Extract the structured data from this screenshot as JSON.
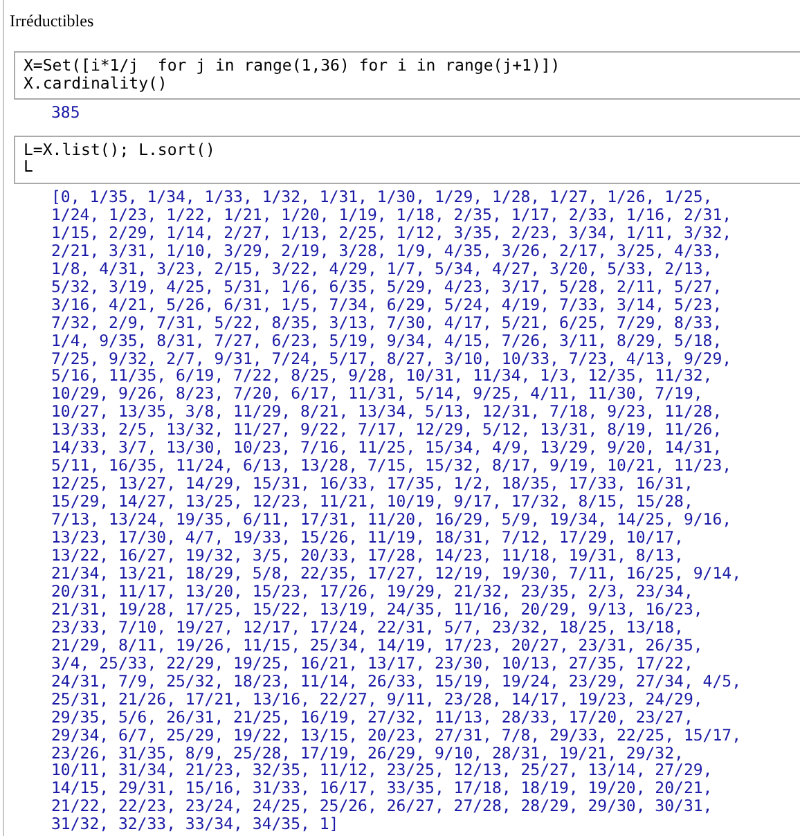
{
  "worksheet": {
    "title": "Irréductibles"
  },
  "cells": [
    {
      "input": [
        "X=Set([i*1/j  for j in range(1,36) for i in range(j+1)])",
        "X.cardinality()"
      ],
      "output": [
        "385"
      ]
    },
    {
      "input": [
        "L=X.list(); L.sort()",
        "L"
      ],
      "output": [
        "[0, 1/35, 1/34, 1/33, 1/32, 1/31, 1/30, 1/29, 1/28, 1/27, 1/26, 1/25,",
        "1/24, 1/23, 1/22, 1/21, 1/20, 1/19, 1/18, 2/35, 1/17, 2/33, 1/16, 2/31,",
        "1/15, 2/29, 1/14, 2/27, 1/13, 2/25, 1/12, 3/35, 2/23, 3/34, 1/11, 3/32,",
        "2/21, 3/31, 1/10, 3/29, 2/19, 3/28, 1/9, 4/35, 3/26, 2/17, 3/25, 4/33,",
        "1/8, 4/31, 3/23, 2/15, 3/22, 4/29, 1/7, 5/34, 4/27, 3/20, 5/33, 2/13,",
        "5/32, 3/19, 4/25, 5/31, 1/6, 6/35, 5/29, 4/23, 3/17, 5/28, 2/11, 5/27,",
        "3/16, 4/21, 5/26, 6/31, 1/5, 7/34, 6/29, 5/24, 4/19, 7/33, 3/14, 5/23,",
        "7/32, 2/9, 7/31, 5/22, 8/35, 3/13, 7/30, 4/17, 5/21, 6/25, 7/29, 8/33,",
        "1/4, 9/35, 8/31, 7/27, 6/23, 5/19, 9/34, 4/15, 7/26, 3/11, 8/29, 5/18,",
        "7/25, 9/32, 2/7, 9/31, 7/24, 5/17, 8/27, 3/10, 10/33, 7/23, 4/13, 9/29,",
        "5/16, 11/35, 6/19, 7/22, 8/25, 9/28, 10/31, 11/34, 1/3, 12/35, 11/32,",
        "10/29, 9/26, 8/23, 7/20, 6/17, 11/31, 5/14, 9/25, 4/11, 11/30, 7/19,",
        "10/27, 13/35, 3/8, 11/29, 8/21, 13/34, 5/13, 12/31, 7/18, 9/23, 11/28,",
        "13/33, 2/5, 13/32, 11/27, 9/22, 7/17, 12/29, 5/12, 13/31, 8/19, 11/26,",
        "14/33, 3/7, 13/30, 10/23, 7/16, 11/25, 15/34, 4/9, 13/29, 9/20, 14/31,",
        "5/11, 16/35, 11/24, 6/13, 13/28, 7/15, 15/32, 8/17, 9/19, 10/21, 11/23,",
        "12/25, 13/27, 14/29, 15/31, 16/33, 17/35, 1/2, 18/35, 17/33, 16/31,",
        "15/29, 14/27, 13/25, 12/23, 11/21, 10/19, 9/17, 17/32, 8/15, 15/28,",
        "7/13, 13/24, 19/35, 6/11, 17/31, 11/20, 16/29, 5/9, 19/34, 14/25, 9/16,",
        "13/23, 17/30, 4/7, 19/33, 15/26, 11/19, 18/31, 7/12, 17/29, 10/17,",
        "13/22, 16/27, 19/32, 3/5, 20/33, 17/28, 14/23, 11/18, 19/31, 8/13,",
        "21/34, 13/21, 18/29, 5/8, 22/35, 17/27, 12/19, 19/30, 7/11, 16/25, 9/14,",
        "20/31, 11/17, 13/20, 15/23, 17/26, 19/29, 21/32, 23/35, 2/3, 23/34,",
        "21/31, 19/28, 17/25, 15/22, 13/19, 24/35, 11/16, 20/29, 9/13, 16/23,",
        "23/33, 7/10, 19/27, 12/17, 17/24, 22/31, 5/7, 23/32, 18/25, 13/18,",
        "21/29, 8/11, 19/26, 11/15, 25/34, 14/19, 17/23, 20/27, 23/31, 26/35,",
        "3/4, 25/33, 22/29, 19/25, 16/21, 13/17, 23/30, 10/13, 27/35, 17/22,",
        "24/31, 7/9, 25/32, 18/23, 11/14, 26/33, 15/19, 19/24, 23/29, 27/34, 4/5,",
        "25/31, 21/26, 17/21, 13/16, 22/27, 9/11, 23/28, 14/17, 19/23, 24/29,",
        "29/35, 5/6, 26/31, 21/25, 16/19, 27/32, 11/13, 28/33, 17/20, 23/27,",
        "29/34, 6/7, 25/29, 19/22, 13/15, 20/23, 27/31, 7/8, 29/33, 22/25, 15/17,",
        "23/26, 31/35, 8/9, 25/28, 17/19, 26/29, 9/10, 28/31, 19/21, 29/32,",
        "10/11, 31/34, 21/23, 32/35, 11/12, 23/25, 12/13, 25/27, 13/14, 27/29,",
        "14/15, 29/31, 15/16, 31/33, 16/17, 33/35, 17/18, 18/19, 19/20, 20/21,",
        "21/22, 22/23, 23/24, 24/25, 25/26, 26/27, 27/28, 28/29, 29/30, 30/31,",
        "31/32, 32/33, 33/34, 34/35, 1]"
      ]
    }
  ]
}
